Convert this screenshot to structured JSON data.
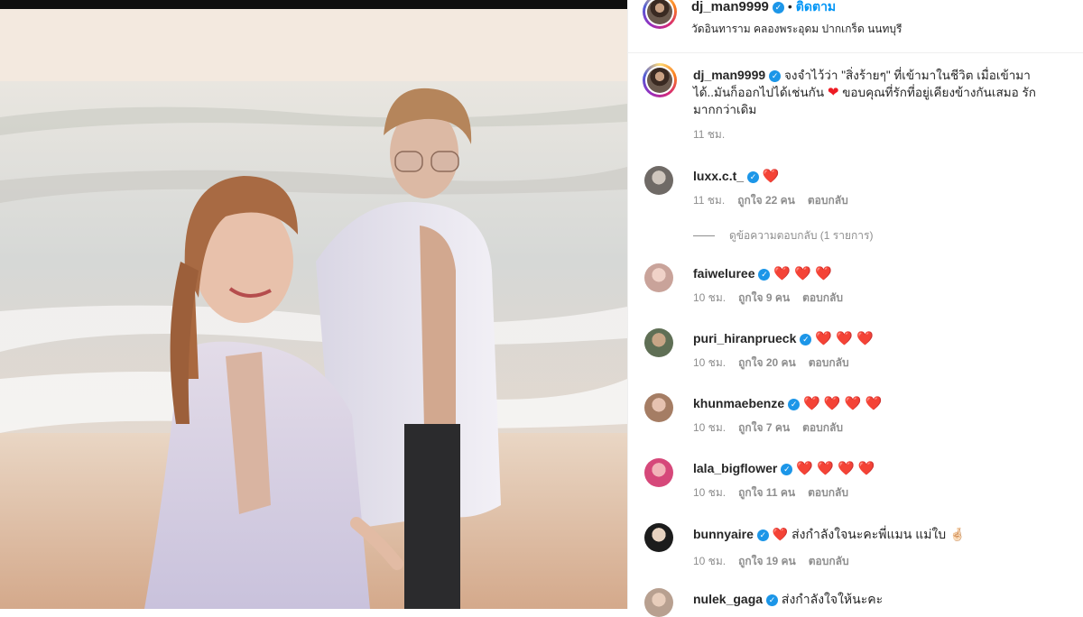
{
  "post": {
    "image_alt": "",
    "author": "dj_man9999",
    "follow_label": "ติดตาม",
    "dot": "•",
    "location": "วัดอินทาราม คลองพระอุดม ปากเกร็ด นนทบุรี",
    "caption_part1": "จงจำไว้ว่า \"สิ่งร้ายๆ\" ที่เข้ามาในชีวิต เมื่อเข้ามา",
    "caption_part2": "ได้..มันก็ออกไปได้เช่นกัน",
    "caption_part3": "ขอบคุณที่รักที่อยู่เคียงข้างกันเสมอ รัก",
    "caption_part4": "มากกว่าเดิม",
    "caption_time": "11 ชม."
  },
  "icons": {
    "verified": "verified-badge-icon",
    "heart": "heart-emoji",
    "hand": "hand-emoji"
  },
  "colors": {
    "accent": "#0095f6",
    "verified": "#1c96e8",
    "heart": "#ed1c24",
    "muted": "#8e8e8e"
  },
  "comments": [
    {
      "user": "luxx.c.t_",
      "text": "❤️",
      "time": "11 ชม.",
      "likes": "ถูกใจ 22 คน",
      "reply": "ตอบกลับ"
    },
    {
      "user": "faiweluree",
      "text": "❤️ ❤️ ❤️",
      "time": "10 ชม.",
      "likes": "ถูกใจ 9 คน",
      "reply": "ตอบกลับ"
    },
    {
      "user": "puri_hiranprueck",
      "text": "❤️ ❤️ ❤️",
      "time": "10 ชม.",
      "likes": "ถูกใจ 20 คน",
      "reply": "ตอบกลับ"
    },
    {
      "user": "khunmaebenze",
      "text": "❤️ ❤️ ❤️ ❤️",
      "time": "10 ชม.",
      "likes": "ถูกใจ 7 คน",
      "reply": "ตอบกลับ"
    },
    {
      "user": "lala_bigflower",
      "text": "❤️ ❤️ ❤️ ❤️",
      "time": "10 ชม.",
      "likes": "ถูกใจ 11 คน",
      "reply": "ตอบกลับ"
    },
    {
      "user": "bunnyaire",
      "text": "❤️ ส่งกำลังใจนะคะพี่แมน แม่ใบ 🤞🏻",
      "time": "10 ชม.",
      "likes": "ถูกใจ 19 คน",
      "reply": "ตอบกลับ"
    },
    {
      "user": "nulek_gaga",
      "text": "ส่งกำลังใจให้นะคะ",
      "time": "",
      "likes": "",
      "reply": ""
    }
  ],
  "view_replies": "ดูข้อความตอบกลับ (1 รายการ)"
}
